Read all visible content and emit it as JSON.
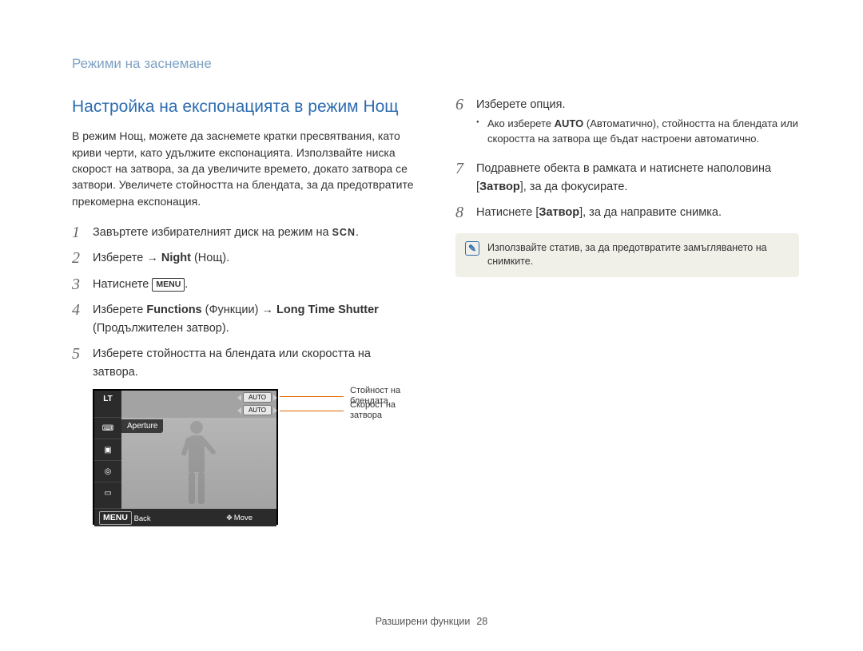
{
  "header": {
    "chapter": "Режими на заснемане"
  },
  "left": {
    "title": "Настройка на експонацията в режим Нощ",
    "intro": "В режим Нощ, можете да заснемете кратки пресвятвания, като криви черти, като удължите експонацията. Използвайте ниска скорост на затвора, за да увеличите времето, докато затвора се затвори. Увеличете стойността на блендата, за да предотвратите прекомерна експонация.",
    "step1_a": "Завъртете избирателният диск на режим на ",
    "step1_scn": "SCN",
    "step2_a": "Изберете → ",
    "step2_b": "Night",
    "step2_c": " (Нощ).",
    "step3_a": "Натиснете ",
    "step3_btn": "MENU",
    "step4_a": "Изберете ",
    "step4_b": "Functions",
    "step4_c": " (Функции) → ",
    "step4_d": "Long Time Shutter",
    "step4_e": " (Продължителен затвор).",
    "step5": "Изберете стойността на блендата или скоростта на затвора."
  },
  "lcd": {
    "lt": "LT",
    "auto1": "AUTO",
    "auto2": "AUTO",
    "aperture": "Aperture",
    "menu_btn": "MENU",
    "back": "Back",
    "move": "Move"
  },
  "callouts": {
    "c1": "Стойност на блендата",
    "c2": "Скорост на затвора"
  },
  "right": {
    "step6": "Изберете опция.",
    "step6_bullet_a": "Ако изберете ",
    "step6_bullet_b": "AUTO",
    "step6_bullet_c": " (Автоматично), стойността на блендата или скоростта на затвора ще бъдат настроени автоматично.",
    "step7_a": "Подравнете обекта в рамката и натиснете наполовина [",
    "step7_b": "Затвор",
    "step7_c": "], за да фокусирате.",
    "step8_a": "Натиснете [",
    "step8_b": "Затвор",
    "step8_c": "], за да направите снимка.",
    "note": "Използвайте статив, за да предотвратите замъгляването на снимките."
  },
  "footer": {
    "section": "Разширени функции",
    "page": "28"
  }
}
